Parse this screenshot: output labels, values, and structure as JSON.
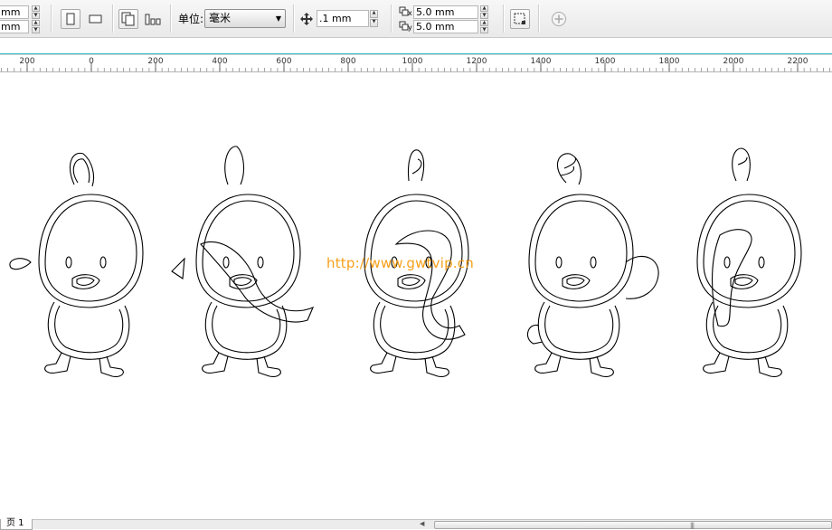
{
  "propbar": {
    "width_value": "mm",
    "height_value": "mm",
    "units_label": "单位:",
    "units_value": "毫米",
    "nudge_value": ".1 mm",
    "dup_x_value": "5.0 mm",
    "dup_y_value": "5.0 mm",
    "dup_x_icon_label": "x",
    "dup_y_icon_label": "y"
  },
  "ruler": {
    "ticks": [
      "200",
      "0",
      "200",
      "400",
      "600",
      "800",
      "1000",
      "1200",
      "1400",
      "1600",
      "1800",
      "2000",
      "2200"
    ]
  },
  "canvas": {
    "watermark": "http://www.gwtvip.cn"
  },
  "status": {
    "page_tab": "页 1"
  },
  "colors": {
    "accent_line": "#2bb3c0",
    "watermark": "#f6a01a"
  }
}
